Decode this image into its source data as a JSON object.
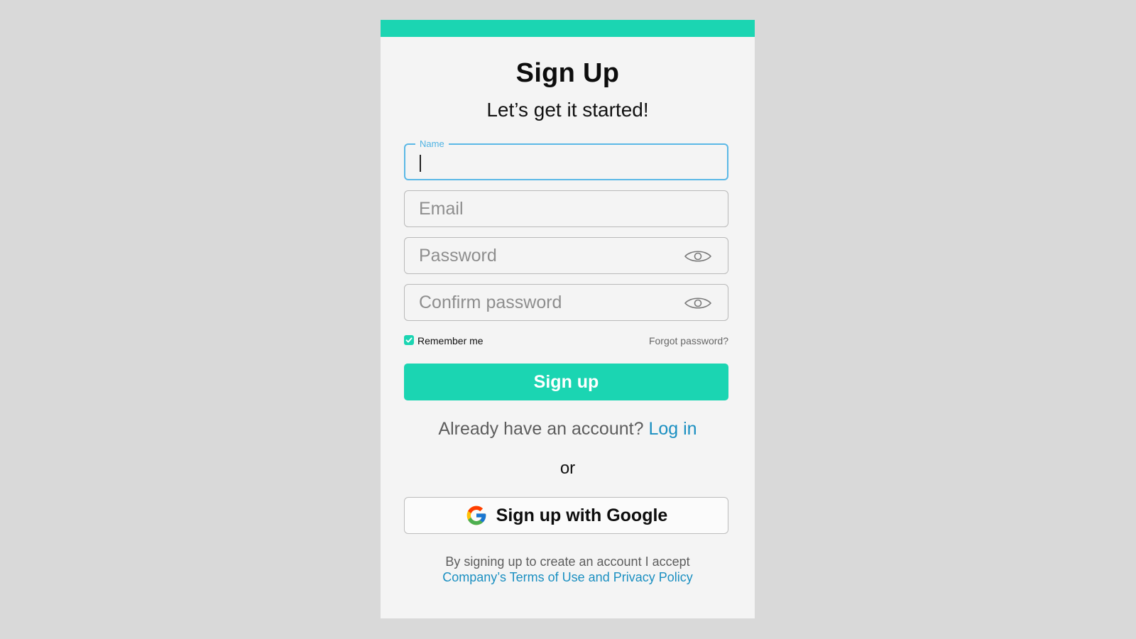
{
  "header": {
    "title": "Sign Up",
    "subtitle": "Let’s get it started!"
  },
  "form": {
    "name_label": "Name",
    "name_value": "",
    "email_placeholder": "Email",
    "password_placeholder": "Password",
    "confirm_password_placeholder": "Confirm password",
    "remember_me_label": "Remember me",
    "remember_me_checked": true,
    "forgot_password_label": "Forgot password?",
    "submit_label": "Sign up"
  },
  "login_prompt": {
    "text": "Already have an account?",
    "link": "Log in"
  },
  "divider_text": "or",
  "google": {
    "label": "Sign up with Google",
    "icon": "google-icon"
  },
  "terms": {
    "text": "By signing up to create an account I accept",
    "link": "Company’s Terms of Use and Privacy Policy"
  },
  "icons": {
    "password_toggle": "eye-icon",
    "confirm_toggle": "eye-icon",
    "checkbox": "check-icon"
  },
  "colors": {
    "accent": "#1bd5b2",
    "link": "#1a8fc1",
    "focus": "#5bb8e6",
    "background": "#d9d9d9",
    "card": "#f4f4f4"
  }
}
